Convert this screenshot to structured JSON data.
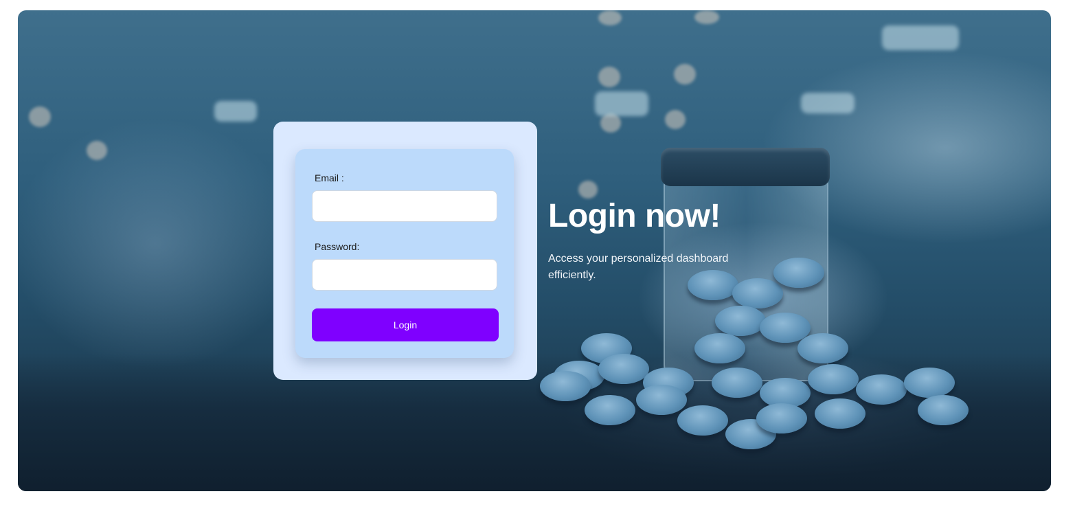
{
  "login_form": {
    "email_label": "Email :",
    "email_value": "",
    "email_placeholder": "",
    "password_label": "Password:",
    "password_value": "",
    "password_placeholder": "",
    "submit_label": "Login",
    "submit_color": "#7f00ff"
  },
  "hero": {
    "title": "Login now!",
    "subtitle": "Access your personalized dashboard efficiently."
  },
  "colors": {
    "card_outer": "#dbe9ff",
    "card_inner": "#bcdafb",
    "accent": "#7f00ff"
  }
}
